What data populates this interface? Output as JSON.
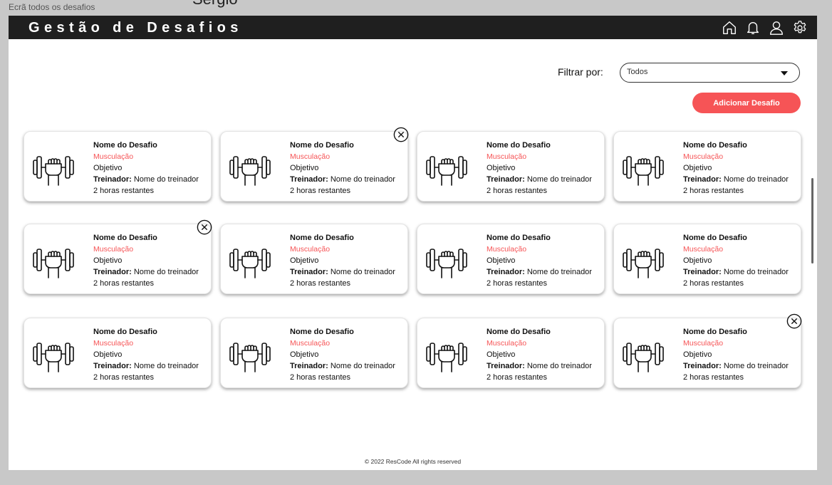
{
  "canvas_label": "Ecrã todos os desafios",
  "author_label": "Sergio",
  "header": {
    "title": "Gestão de Desafios",
    "icons": [
      "home-icon",
      "bell-icon",
      "user-icon",
      "gear-icon"
    ]
  },
  "filter": {
    "label": "Filtrar por:",
    "value": "Todos"
  },
  "add_button": {
    "label": "Adicionar Desafio"
  },
  "colors": {
    "accent": "#f65456",
    "header_bg": "#1f1f1f"
  },
  "cards": [
    {
      "name": "Nome do Desafio",
      "category": "Musculação",
      "objective": "Objetivo",
      "trainer_label": "Treinador:",
      "trainer": "Nome do treinador",
      "remaining": "2 horas restantes",
      "icon": "dumbbell-hand-icon",
      "removable": false
    },
    {
      "name": "Nome do Desafio",
      "category": "Musculação",
      "objective": "Objetivo",
      "trainer_label": "Treinador:",
      "trainer": "Nome do treinador",
      "remaining": "2 horas restantes",
      "icon": "dumbbell-hand-icon",
      "removable": true
    },
    {
      "name": "Nome do Desafio",
      "category": "Musculação",
      "objective": "Objetivo",
      "trainer_label": "Treinador:",
      "trainer": "Nome do treinador",
      "remaining": "2 horas restantes",
      "icon": "dumbbell-hand-icon",
      "removable": false
    },
    {
      "name": "Nome do Desafio",
      "category": "Musculação",
      "objective": "Objetivo",
      "trainer_label": "Treinador:",
      "trainer": "Nome do treinador",
      "remaining": "2 horas restantes",
      "icon": "dumbbell-hand-icon",
      "removable": false
    },
    {
      "name": "Nome do Desafio",
      "category": "Musculação",
      "objective": "Objetivo",
      "trainer_label": "Treinador:",
      "trainer": "Nome do treinador",
      "remaining": "2 horas restantes",
      "icon": "dumbbell-hand-icon",
      "removable": true
    },
    {
      "name": "Nome do Desafio",
      "category": "Musculação",
      "objective": "Objetivo",
      "trainer_label": "Treinador:",
      "trainer": "Nome do treinador",
      "remaining": "2 horas restantes",
      "icon": "dumbbell-hand-icon",
      "removable": false
    },
    {
      "name": "Nome do Desafio",
      "category": "Musculação",
      "objective": "Objetivo",
      "trainer_label": "Treinador:",
      "trainer": "Nome do treinador",
      "remaining": "2 horas restantes",
      "icon": "dumbbell-hand-icon",
      "removable": false
    },
    {
      "name": "Nome do Desafio",
      "category": "Musculação",
      "objective": "Objetivo",
      "trainer_label": "Treinador:",
      "trainer": "Nome do treinador",
      "remaining": "2 horas restantes",
      "icon": "dumbbell-hand-icon",
      "removable": false
    },
    {
      "name": "Nome do Desafio",
      "category": "Musculação",
      "objective": "Objetivo",
      "trainer_label": "Treinador:",
      "trainer": "Nome do treinador",
      "remaining": "2 horas restantes",
      "icon": "dumbbell-hand-icon",
      "removable": false
    },
    {
      "name": "Nome do Desafio",
      "category": "Musculação",
      "objective": "Objetivo",
      "trainer_label": "Treinador:",
      "trainer": "Nome do treinador",
      "remaining": "2 horas restantes",
      "icon": "dumbbell-hand-icon",
      "removable": false
    },
    {
      "name": "Nome do Desafio",
      "category": "Musculação",
      "objective": "Objetivo",
      "trainer_label": "Treinador:",
      "trainer": "Nome do treinador",
      "remaining": "2 horas restantes",
      "icon": "dumbbell-hand-icon",
      "removable": false
    },
    {
      "name": "Nome do Desafio",
      "category": "Musculação",
      "objective": "Objetivo",
      "trainer_label": "Treinador:",
      "trainer": "Nome do treinador",
      "remaining": "2 horas restantes",
      "icon": "dumbbell-hand-icon",
      "removable": true
    }
  ],
  "footer": {
    "text": "© 2022 ResCode All rights reserved"
  }
}
